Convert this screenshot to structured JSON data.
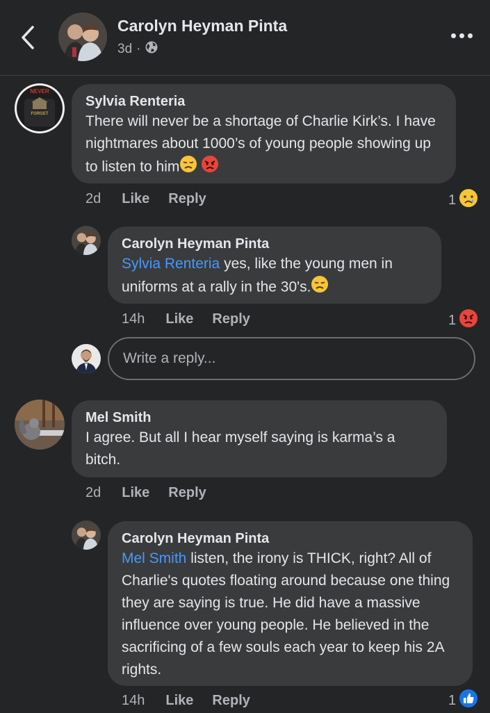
{
  "header": {
    "name": "Carolyn Heyman Pinta",
    "time": "3d",
    "separator": "·"
  },
  "comments": [
    {
      "author": "Sylvia Renteria",
      "text": "There will never be a shortage of Charlie Kirk’s. I have nightmares about 1000’s of young people showing up to listen to him",
      "time": "2d",
      "like": "Like",
      "reply": "Reply",
      "reaction_count": "1",
      "avatar_text": [
        "NEVER",
        "FORGET"
      ]
    },
    {
      "author": "Carolyn Heyman Pinta",
      "mention": "Sylvia Renteria",
      "text": " yes, like the young men in uniforms at a rally in the 30's.",
      "time": "14h",
      "like": "Like",
      "reply": "Reply",
      "reaction_count": "1"
    },
    {
      "author": "Mel Smith",
      "text": "I agree. But all I hear myself saying is karma’s a bitch.",
      "time": "2d",
      "like": "Like",
      "reply": "Reply"
    },
    {
      "author": "Carolyn Heyman Pinta",
      "mention": "Mel Smith",
      "text": " listen, the irony is THICK, right? All of Charlie's quotes floating around because one thing they are saying is true. He did have a massive influence over young people. He believed in the sacrificing of a few souls each year to keep his 2A rights.",
      "time": "14h",
      "like": "Like",
      "reply": "Reply",
      "reaction_count": "1"
    }
  ],
  "reply_box": {
    "placeholder": "Write a reply..."
  },
  "colors": {
    "background": "#242526",
    "bubble": "#3a3b3c",
    "mention": "#4599ff",
    "secondary_text": "#b0b3b8"
  },
  "icons": [
    "back-arrow-icon",
    "globe-icon",
    "more-icon",
    "sad-emoji-icon",
    "angry-emoji-icon",
    "like-thumb-icon"
  ]
}
